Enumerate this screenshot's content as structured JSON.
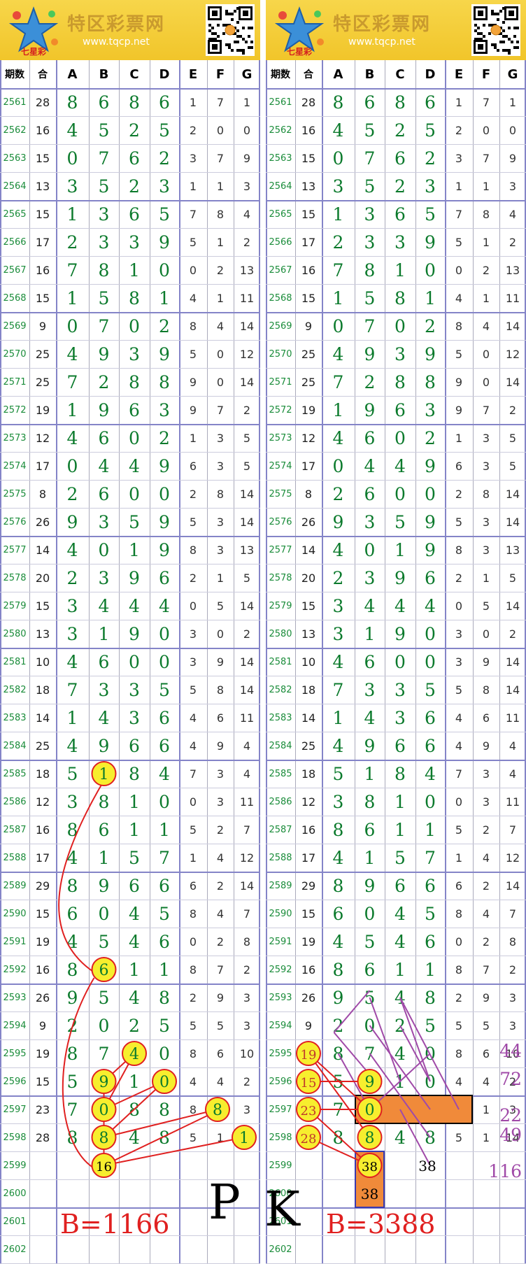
{
  "site": {
    "logo_text": "特区彩票网",
    "url": "www.tqcp.net",
    "emblem_text": "七星彩"
  },
  "columns": [
    "期数",
    "合",
    "A",
    "B",
    "C",
    "D",
    "E",
    "F",
    "G"
  ],
  "rows": [
    [
      "2561",
      "28",
      "8",
      "6",
      "8",
      "6",
      "1",
      "7",
      "1"
    ],
    [
      "2562",
      "16",
      "4",
      "5",
      "2",
      "5",
      "2",
      "0",
      "0"
    ],
    [
      "2563",
      "15",
      "0",
      "7",
      "6",
      "2",
      "3",
      "7",
      "9"
    ],
    [
      "2564",
      "13",
      "3",
      "5",
      "2",
      "3",
      "1",
      "1",
      "3"
    ],
    [
      "2565",
      "15",
      "1",
      "3",
      "6",
      "5",
      "7",
      "8",
      "4"
    ],
    [
      "2566",
      "17",
      "2",
      "3",
      "3",
      "9",
      "5",
      "1",
      "2"
    ],
    [
      "2567",
      "16",
      "7",
      "8",
      "1",
      "0",
      "0",
      "2",
      "13"
    ],
    [
      "2568",
      "15",
      "1",
      "5",
      "8",
      "1",
      "4",
      "1",
      "11"
    ],
    [
      "2569",
      "9",
      "0",
      "7",
      "0",
      "2",
      "8",
      "4",
      "14"
    ],
    [
      "2570",
      "25",
      "4",
      "9",
      "3",
      "9",
      "5",
      "0",
      "12"
    ],
    [
      "2571",
      "25",
      "7",
      "2",
      "8",
      "8",
      "9",
      "0",
      "14"
    ],
    [
      "2572",
      "19",
      "1",
      "9",
      "6",
      "3",
      "9",
      "7",
      "2"
    ],
    [
      "2573",
      "12",
      "4",
      "6",
      "0",
      "2",
      "1",
      "3",
      "5"
    ],
    [
      "2574",
      "17",
      "0",
      "4",
      "4",
      "9",
      "6",
      "3",
      "5"
    ],
    [
      "2575",
      "8",
      "2",
      "6",
      "0",
      "0",
      "2",
      "8",
      "14"
    ],
    [
      "2576",
      "26",
      "9",
      "3",
      "5",
      "9",
      "5",
      "3",
      "14"
    ],
    [
      "2577",
      "14",
      "4",
      "0",
      "1",
      "9",
      "8",
      "3",
      "13"
    ],
    [
      "2578",
      "20",
      "2",
      "3",
      "9",
      "6",
      "2",
      "1",
      "5"
    ],
    [
      "2579",
      "15",
      "3",
      "4",
      "4",
      "4",
      "0",
      "5",
      "14"
    ],
    [
      "2580",
      "13",
      "3",
      "1",
      "9",
      "0",
      "3",
      "0",
      "2"
    ],
    [
      "2581",
      "10",
      "4",
      "6",
      "0",
      "0",
      "3",
      "9",
      "14"
    ],
    [
      "2582",
      "18",
      "7",
      "3",
      "3",
      "5",
      "5",
      "8",
      "14"
    ],
    [
      "2583",
      "14",
      "1",
      "4",
      "3",
      "6",
      "4",
      "6",
      "11"
    ],
    [
      "2584",
      "25",
      "4",
      "9",
      "6",
      "6",
      "4",
      "9",
      "4"
    ],
    [
      "2585",
      "18",
      "5",
      "1",
      "8",
      "4",
      "7",
      "3",
      "4"
    ],
    [
      "2586",
      "12",
      "3",
      "8",
      "1",
      "0",
      "0",
      "3",
      "11"
    ],
    [
      "2587",
      "16",
      "8",
      "6",
      "1",
      "1",
      "5",
      "2",
      "7"
    ],
    [
      "2588",
      "17",
      "4",
      "1",
      "5",
      "7",
      "1",
      "4",
      "12"
    ],
    [
      "2589",
      "29",
      "8",
      "9",
      "6",
      "6",
      "6",
      "2",
      "14"
    ],
    [
      "2590",
      "15",
      "6",
      "0",
      "4",
      "5",
      "8",
      "4",
      "7"
    ],
    [
      "2591",
      "19",
      "4",
      "5",
      "4",
      "6",
      "0",
      "2",
      "8"
    ],
    [
      "2592",
      "16",
      "8",
      "6",
      "1",
      "1",
      "8",
      "7",
      "2"
    ],
    [
      "2593",
      "26",
      "9",
      "5",
      "4",
      "8",
      "2",
      "9",
      "3"
    ],
    [
      "2594",
      "9",
      "2",
      "0",
      "2",
      "5",
      "5",
      "5",
      "3"
    ],
    [
      "2595",
      "19",
      "8",
      "7",
      "4",
      "0",
      "8",
      "6",
      "10"
    ],
    [
      "2596",
      "15",
      "5",
      "9",
      "1",
      "0",
      "4",
      "4",
      "2"
    ],
    [
      "2597",
      "23",
      "7",
      "0",
      "8",
      "8",
      "8",
      "1",
      "3"
    ],
    [
      "2598",
      "28",
      "8",
      "8",
      "4",
      "8",
      "5",
      "1",
      "14"
    ],
    [
      "2599",
      "",
      "",
      "",
      "",
      "",
      "",
      "",
      ""
    ],
    [
      "2600",
      "",
      "",
      "",
      "",
      "",
      "",
      "",
      ""
    ],
    [
      "2601",
      "",
      "",
      "",
      "",
      "",
      "",
      "",
      ""
    ],
    [
      "2602",
      "",
      "",
      "",
      "",
      "",
      "",
      "",
      ""
    ]
  ],
  "left_panel": {
    "prediction": "16",
    "b_value": "B=1166"
  },
  "right_panel": {
    "prediction_b": "38",
    "prediction_b2": "38",
    "prediction_c": "38",
    "b_value": "B=3388",
    "notes": [
      "44",
      "72",
      "22",
      "49",
      "116"
    ]
  },
  "pk_left": "P",
  "pk_right": "K",
  "colors": {
    "accent_red": "#e02020",
    "circle_fill": "#f7ee2e",
    "highlight": "#f08a3a",
    "note": "#a04aa8",
    "digit_green": "#0b7a2c"
  }
}
